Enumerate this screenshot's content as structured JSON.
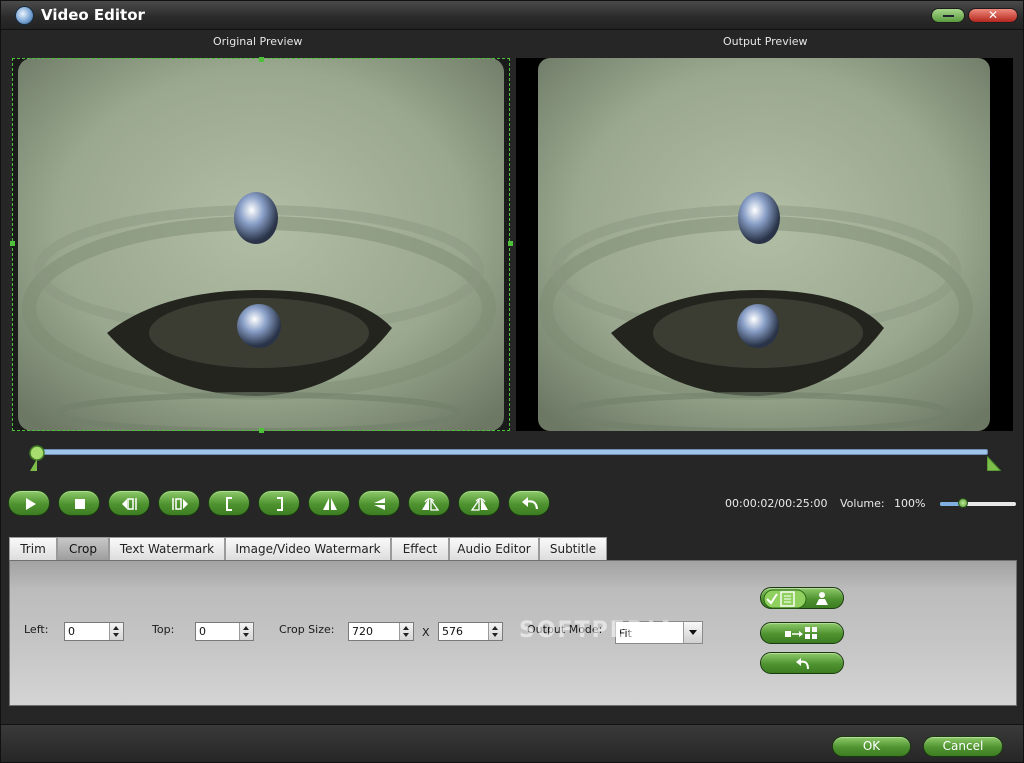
{
  "window": {
    "title": "Video Editor",
    "icons": {
      "app": "video-converter-icon",
      "minimize": "minimize-icon",
      "close": "close-icon"
    }
  },
  "preview": {
    "original_label": "Original Preview",
    "output_label": "Output Preview"
  },
  "playback": {
    "buttons": [
      {
        "name": "play-button",
        "icon": "play-icon"
      },
      {
        "name": "stop-button",
        "icon": "stop-icon"
      },
      {
        "name": "previous-frame-button",
        "icon": "previous-frame-icon"
      },
      {
        "name": "next-frame-button",
        "icon": "next-frame-icon"
      },
      {
        "name": "set-start-button",
        "icon": "bracket-left-icon"
      },
      {
        "name": "set-end-button",
        "icon": "bracket-right-icon"
      },
      {
        "name": "flip-horizontal-button",
        "icon": "flip-horizontal-icon"
      },
      {
        "name": "flip-vertical-button",
        "icon": "flip-vertical-icon"
      },
      {
        "name": "rotate-left-button",
        "icon": "rotate-left-icon"
      },
      {
        "name": "rotate-right-button",
        "icon": "rotate-right-icon"
      },
      {
        "name": "undo-button",
        "icon": "undo-icon"
      }
    ],
    "time": "00:00:02/00:25:00",
    "volume_label": "Volume:",
    "volume_value": "100%",
    "volume_level": 0.3,
    "timeline_position": 0.0
  },
  "tabs": [
    {
      "label": "Trim",
      "active": false
    },
    {
      "label": "Crop",
      "active": true
    },
    {
      "label": "Text Watermark",
      "active": false
    },
    {
      "label": "Image/Video Watermark",
      "active": false
    },
    {
      "label": "Effect",
      "active": false
    },
    {
      "label": "Audio Editor",
      "active": false
    },
    {
      "label": "Subtitle",
      "active": false
    }
  ],
  "crop": {
    "left_label": "Left:",
    "left_value": "0",
    "top_label": "Top:",
    "top_value": "0",
    "size_label": "Crop Size:",
    "width_value": "720",
    "x_label": "X",
    "height_value": "576",
    "output_mode_label": "Output Mode:",
    "output_mode_value": "Fit",
    "side_buttons": [
      {
        "name": "apply-to-all-button",
        "icons": [
          "checked-icon",
          "document-icon",
          "user-icon"
        ]
      },
      {
        "name": "center-crop-button",
        "icons": [
          "move-to-grid-icon"
        ]
      },
      {
        "name": "reset-crop-button",
        "icons": [
          "undo-icon"
        ]
      }
    ]
  },
  "watermark_text": "SOFTPEDIA",
  "footer": {
    "ok_label": "OK",
    "cancel_label": "Cancel"
  },
  "colors": {
    "accent_green": "#4f9330",
    "crop_border": "#4ec03a",
    "timeline": "#9fc4ea"
  }
}
